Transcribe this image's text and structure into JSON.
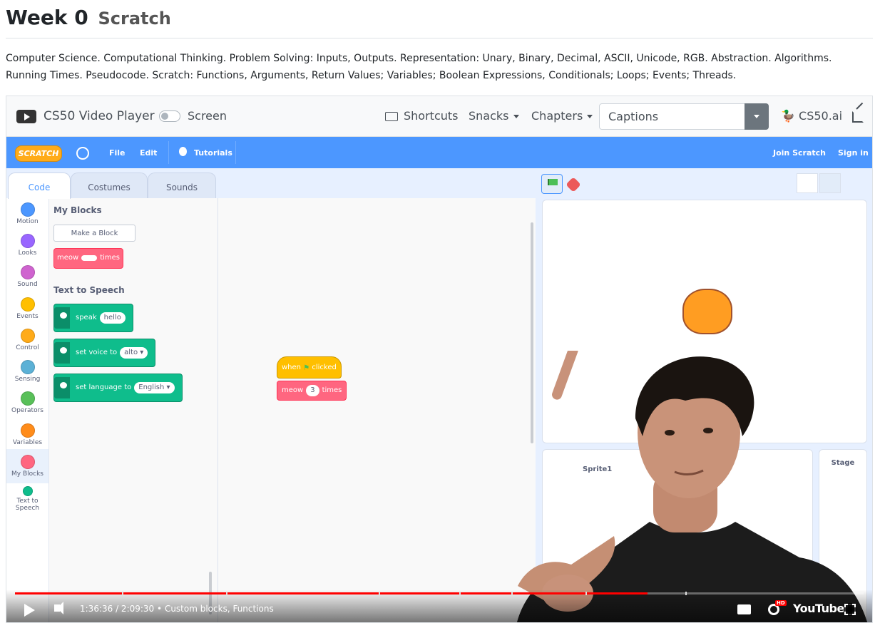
{
  "page": {
    "title": "Week 0",
    "subtitle": "Scratch",
    "description": "Computer Science. Computational Thinking. Problem Solving: Inputs, Outputs. Representation: Unary, Binary, Decimal, ASCII, Unicode, RGB. Abstraction. Algorithms. Running Times. Pseudocode. Scratch: Functions, Arguments, Return Values; Variables; Boolean Expressions, Conditionals; Loops; Events; Threads."
  },
  "player_bar": {
    "app_name": "CS50 Video Player",
    "screen_toggle_label": "Screen",
    "shortcuts_label": "Shortcuts",
    "snacks_label": "Snacks",
    "chapters_label": "Chapters",
    "captions_value": "Captions",
    "cs50ai_label": "CS50.ai"
  },
  "scratch": {
    "logo_text": "SCRATCH",
    "menu": {
      "file": "File",
      "edit": "Edit",
      "tutorials": "Tutorials",
      "join": "Join Scratch",
      "signin": "Sign in"
    },
    "tabs": {
      "code": "Code",
      "costumes": "Costumes",
      "sounds": "Sounds"
    },
    "categories": [
      {
        "label": "Motion",
        "color": "#4c97ff"
      },
      {
        "label": "Looks",
        "color": "#9966ff"
      },
      {
        "label": "Sound",
        "color": "#cf63cf"
      },
      {
        "label": "Events",
        "color": "#ffbf00"
      },
      {
        "label": "Control",
        "color": "#ffab19"
      },
      {
        "label": "Sensing",
        "color": "#5cb1d6"
      },
      {
        "label": "Operators",
        "color": "#59c059"
      },
      {
        "label": "Variables",
        "color": "#ff8c1a"
      },
      {
        "label": "My Blocks",
        "color": "#ff6680"
      },
      {
        "label": "Text to Speech",
        "color": "#0fbd8c"
      }
    ],
    "palette": {
      "my_blocks_heading": "My Blocks",
      "make_block_label": "Make a Block",
      "meow_block": {
        "before": "meow",
        "after": "times"
      },
      "tts_heading": "Text to Speech",
      "speak_block": {
        "label": "speak",
        "value": "hello"
      },
      "voice_block": {
        "label": "set voice to",
        "value": "alto"
      },
      "language_block": {
        "label": "set language to",
        "value": "English"
      }
    },
    "script": {
      "hat_before": "when",
      "hat_after": "clicked",
      "meow_before": "meow",
      "meow_value": "3",
      "meow_after": "times"
    },
    "sprite_name": "Sprite1",
    "stage_label": "Stage"
  },
  "video_controls": {
    "time": "1:36:36 / 2:09:30",
    "separator": "•",
    "chapter": "Custom blocks, Functions",
    "progress": 0.745,
    "youtube_label": "YouTube",
    "hd_badge": "HD"
  }
}
